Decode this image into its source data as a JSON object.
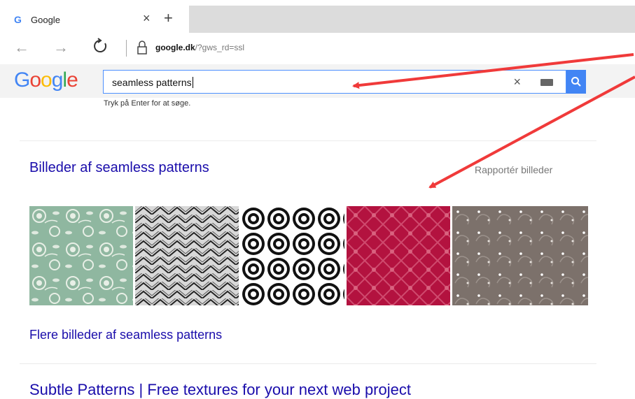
{
  "browser": {
    "tab_favicon": "G",
    "tab_title": "Google",
    "tab_close": "×",
    "new_tab": "+",
    "back": "←",
    "forward": "→",
    "url_host": "google.dk",
    "url_path": "/?gws_rd=ssl"
  },
  "search": {
    "logo": [
      "G",
      "o",
      "o",
      "g",
      "l",
      "e"
    ],
    "query": "seamless patterns",
    "clear": "×",
    "hint": "Tryk på Enter for at søge."
  },
  "results": {
    "images_heading": "Billeder af seamless patterns",
    "report_images": "Rapportér billeder",
    "more_images": "Flere billeder af seamless patterns",
    "next_result_title": "Subtle Patterns | Free textures for your next web project"
  },
  "thumbnails": [
    {
      "pattern": "floral-roses",
      "color": "#8fb7a0"
    },
    {
      "pattern": "chevron-lines",
      "color": "#9a9a9a"
    },
    {
      "pattern": "concentric-circles",
      "color": "#111111"
    },
    {
      "pattern": "diamond-lattice",
      "color": "#b3123f"
    },
    {
      "pattern": "swirl-dots",
      "color": "#7c716b"
    }
  ],
  "colors": {
    "link": "#1a0dab",
    "google_blue": "#4285f4",
    "annotation_arrow": "#f03a3a"
  }
}
